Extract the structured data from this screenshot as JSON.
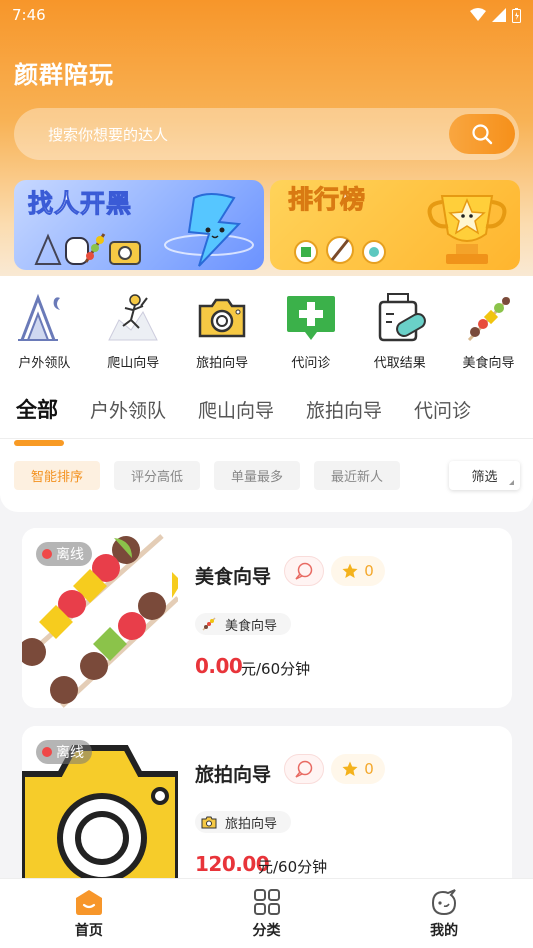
{
  "status_bar": {
    "time": "7:46"
  },
  "app": {
    "title": "颜群陪玩"
  },
  "search": {
    "placeholder": "搜索你想要的达人"
  },
  "banners": [
    {
      "text": "找人开黑"
    },
    {
      "text": "排行榜"
    }
  ],
  "categories": [
    {
      "label": "户外领队",
      "icon": "tent-icon"
    },
    {
      "label": "爬山向导",
      "icon": "climber-icon"
    },
    {
      "label": "旅拍向导",
      "icon": "camera-icon"
    },
    {
      "label": "代问诊",
      "icon": "medical-chat-icon"
    },
    {
      "label": "代取结果",
      "icon": "pill-bottle-icon"
    },
    {
      "label": "美食向导",
      "icon": "skewer-icon"
    }
  ],
  "tabs": [
    {
      "label": "全部",
      "active": true
    },
    {
      "label": "户外领队"
    },
    {
      "label": "爬山向导"
    },
    {
      "label": "旅拍向导"
    },
    {
      "label": "代问诊"
    }
  ],
  "filters": {
    "chips": [
      {
        "label": "智能排序",
        "active": true
      },
      {
        "label": "评分高低"
      },
      {
        "label": "单量最多"
      },
      {
        "label": "最近新人"
      }
    ],
    "filter_button": "筛选"
  },
  "listings": [
    {
      "status": "离线",
      "name": "美食向导",
      "rating": "0",
      "tag": "美食向导",
      "price": "0.00",
      "unit": "元/60分钟",
      "image": "skewer-image"
    },
    {
      "status": "离线",
      "name": "旅拍向导",
      "rating": "0",
      "tag": "旅拍向导",
      "price": "120.00",
      "unit": "元/60分钟",
      "image": "camera-image"
    }
  ],
  "bottom_nav": [
    {
      "label": "首页",
      "icon": "home-icon",
      "active": true
    },
    {
      "label": "分类",
      "icon": "grid-icon"
    },
    {
      "label": "我的",
      "icon": "profile-icon"
    }
  ],
  "colors": {
    "accent": "#f6901a",
    "price": "#e8343a",
    "star": "#f4a82c"
  }
}
